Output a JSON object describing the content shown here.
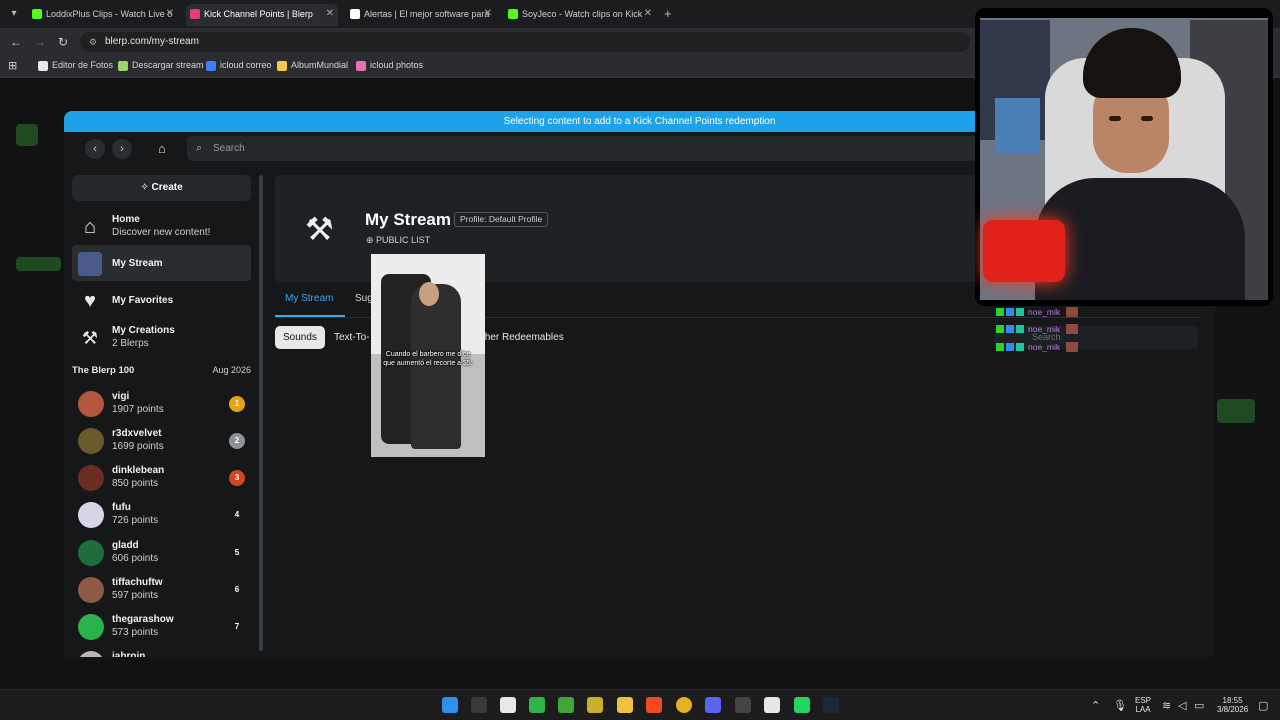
{
  "browser": {
    "tabs": [
      {
        "title": "LoddixPlus Clips - Watch Live o",
        "color": "#53fc18"
      },
      {
        "title": "Kick Channel Points | Blerp",
        "color": "#e63b7a",
        "active": true
      },
      {
        "title": "Alertas | El mejor software para",
        "color": "#ffffff"
      },
      {
        "title": "SoyJeco - Watch clips on Kick",
        "color": "#53fc18"
      }
    ],
    "url": "blerp.com/my-stream",
    "bookmarks": [
      {
        "label": "Editor de Fotos",
        "color": "#e8e8e8"
      },
      {
        "label": "Descargar stream",
        "color": "#9fd36b"
      },
      {
        "label": "icloud correo",
        "color": "#3b82f6"
      },
      {
        "label": "AlbumMundial",
        "color": "#f2c94c"
      },
      {
        "label": "icloud photos",
        "color": "#e86fb0"
      }
    ]
  },
  "banner": "Selecting content to add to a Kick Channel Points redemption",
  "search": {
    "placeholder": "Search"
  },
  "sidebar": {
    "create_label": "Create",
    "nav": [
      {
        "title": "Home",
        "subtitle": "Discover new content!",
        "icon": "house-icon"
      },
      {
        "title": "My Stream",
        "subtitle": "",
        "icon": "stream-avatar",
        "active": true
      },
      {
        "title": "My Favorites",
        "subtitle": "",
        "icon": "heart-icon"
      },
      {
        "title": "My Creations",
        "subtitle": "2 Blerps",
        "icon": "hammer-icon"
      }
    ],
    "leaderboard_title": "The Blerp 100",
    "leaderboard_date": "Aug 2026",
    "leaderboard": [
      {
        "name": "vigi",
        "points": "1907 points",
        "rank": "1",
        "rank_color": "#e3a417",
        "avatar_color": "#b5573e"
      },
      {
        "name": "r3dxvelvet",
        "points": "1699 points",
        "rank": "2",
        "rank_color": "#8e9196",
        "avatar_color": "#6a5a2a"
      },
      {
        "name": "dinklebean",
        "points": "850 points",
        "rank": "3",
        "rank_color": "#d2461d",
        "avatar_color": "#6b2c22"
      },
      {
        "name": "fufu",
        "points": "726 points",
        "rank": "4",
        "rank_color": "transparent",
        "avatar_color": "#d9d3e8"
      },
      {
        "name": "gladd",
        "points": "606 points",
        "rank": "5",
        "rank_color": "transparent",
        "avatar_color": "#1f6d3a"
      },
      {
        "name": "tiffachuftw",
        "points": "597 points",
        "rank": "6",
        "rank_color": "transparent",
        "avatar_color": "#8c5a45"
      },
      {
        "name": "thegarashow",
        "points": "573 points",
        "rank": "7",
        "rank_color": "transparent",
        "avatar_color": "#2bb24c"
      },
      {
        "name": "jabroin",
        "points": "",
        "rank": "",
        "rank_color": "transparent",
        "avatar_color": "#b7b7b7"
      }
    ]
  },
  "main": {
    "title": "My Stream",
    "profile_tag": "Profile: Default Profile",
    "visibility": "PUBLIC LIST",
    "tabs": [
      "My Stream",
      "Sug"
    ],
    "chips": [
      "Sounds",
      "Text-To-",
      "ther Redeemables"
    ]
  },
  "video": {
    "caption": "Cuando el barbero me dice que aumentó el recorte a $5:"
  },
  "overlay_chat": {
    "rows": [
      "noe_mik",
      "noe_mik",
      "noe_mik"
    ],
    "search_placeholder": "Search"
  },
  "taskbar": {
    "lang_top": "ESP",
    "lang_bottom": "LAA",
    "time": "18:55",
    "date": "3/8/2026"
  }
}
